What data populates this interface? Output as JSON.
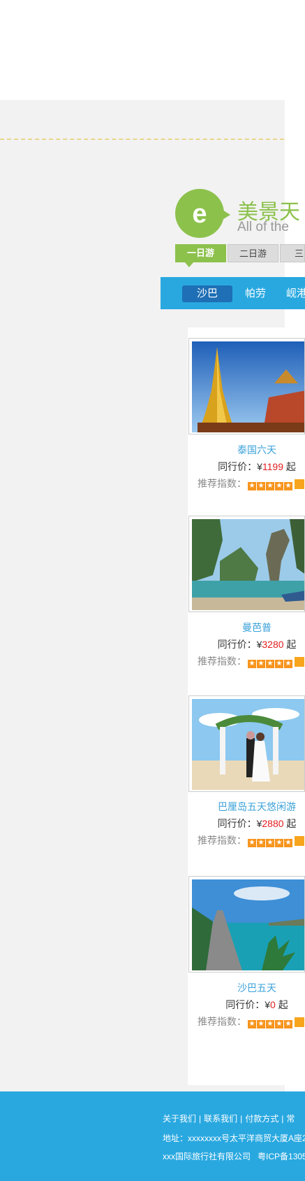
{
  "brand": {
    "name": "美景天",
    "name_en": "All of the",
    "logo_letter": "e"
  },
  "tabs": [
    {
      "label": "一日游"
    },
    {
      "label": "二日游"
    },
    {
      "label": "三日"
    }
  ],
  "nav": [
    {
      "label": "沙巴"
    },
    {
      "label": "帕劳"
    },
    {
      "label": "岘港"
    }
  ],
  "products": [
    {
      "title": "泰国六天",
      "price_prefix": "同行价：¥",
      "price": "1199",
      "price_suffix": "起",
      "rating_label": "推荐指数："
    },
    {
      "title": "曼芭普",
      "price_prefix": "同行价：¥",
      "price": "3280",
      "price_suffix": "起",
      "rating_label": "推荐指数："
    },
    {
      "title": "巴厘岛五天悠闲游",
      "price_prefix": "同行价：¥",
      "price": "2880",
      "price_suffix": "起",
      "rating_label": "推荐指数："
    },
    {
      "title": "沙巴五天",
      "price_prefix": "同行价：¥",
      "price": "0",
      "price_suffix": "起",
      "rating_label": "推荐指数："
    }
  ],
  "footer": {
    "links": [
      "关于我们",
      "联系我们",
      "付款方式",
      "常"
    ],
    "address": "地址：xxxxxxxx号太平洋商贸大厦A座2",
    "company": "xxx国际旅行社有限公司",
    "icp": "粤ICP备1305"
  },
  "colors": {
    "accent_green": "#8cc14c",
    "nav_blue": "#29a8e0",
    "nav_active": "#1e6fb5",
    "title_blue": "#3aa1d9",
    "price_red": "#e21e1e",
    "star_orange": "#f7941d"
  }
}
